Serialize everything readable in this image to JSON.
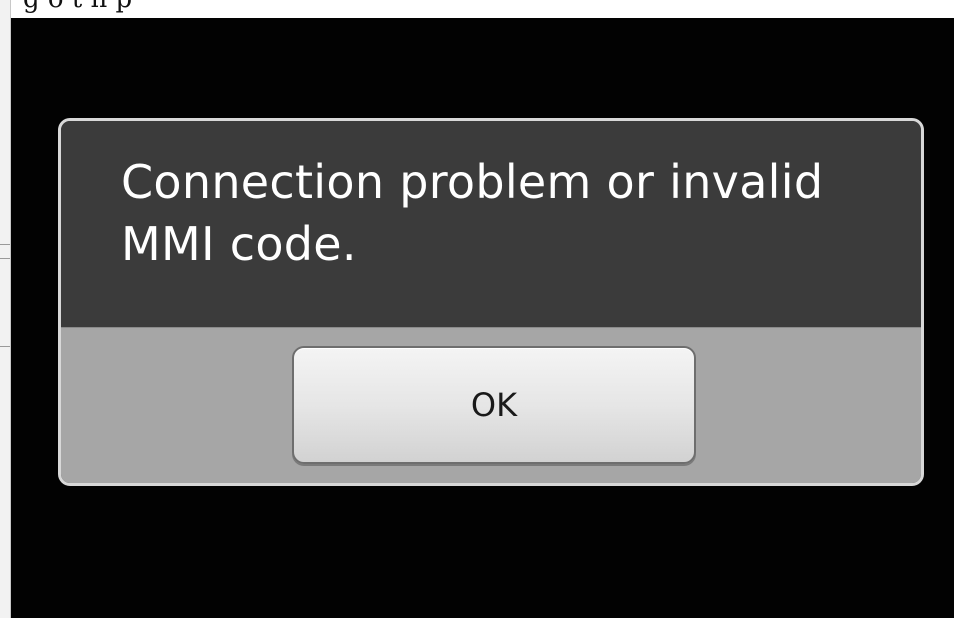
{
  "dialog": {
    "message": "Connection problem or invalid MMI code.",
    "ok_label": "OK"
  },
  "colors": {
    "dialog_body": "#3b3b3b",
    "dialog_footer": "#a6a6a6",
    "button_face": "#e6e6e6",
    "message_text": "#ffffff",
    "screen_background": "#020202"
  }
}
